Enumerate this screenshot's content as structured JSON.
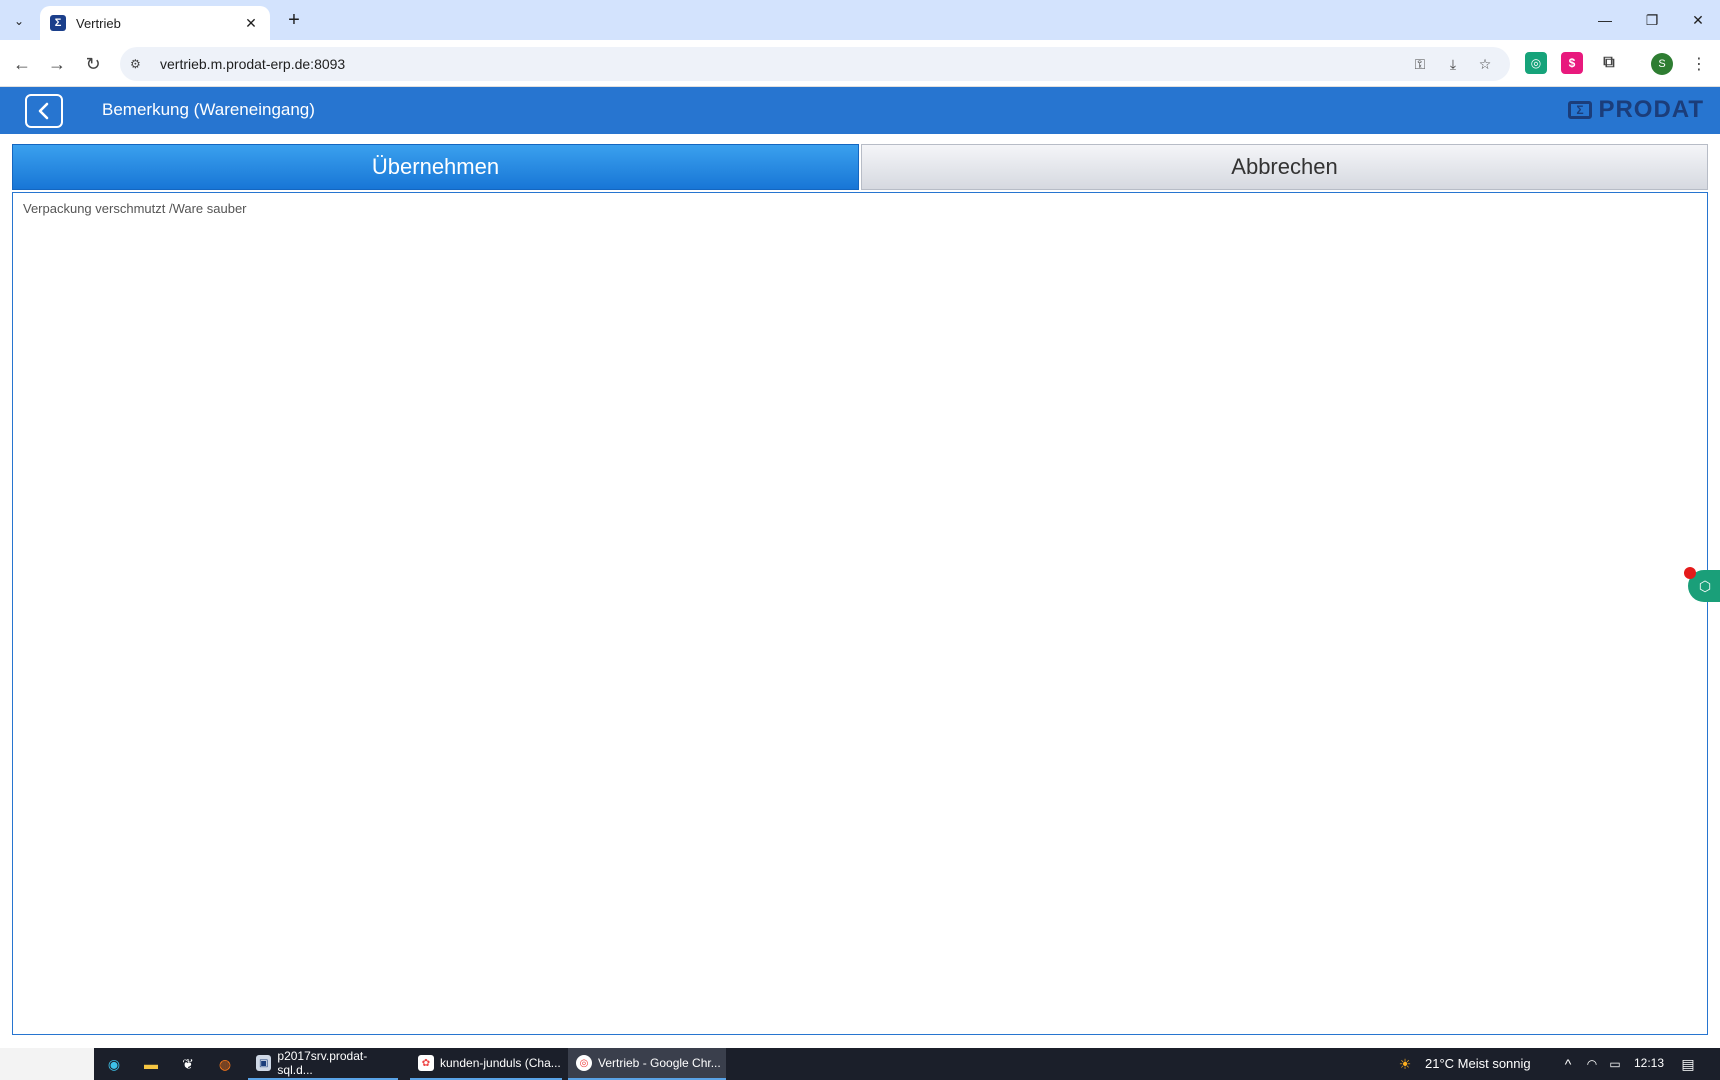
{
  "browser": {
    "tab_title": "Vertrieb",
    "url": "vertrieb.m.prodat-erp.de:8093",
    "new_tab_symbol": "+",
    "close_symbol": "✕",
    "profile_initial": "S"
  },
  "app": {
    "title": "Bemerkung (Wareneingang)",
    "brand": "PRODAT",
    "buttons": {
      "accept": "Übernehmen",
      "cancel": "Abbrechen"
    },
    "remark_text": "Verpackung verschmutzt /Ware sauber"
  },
  "taskbar": {
    "apps": [
      {
        "label": "p2017srv.prodat-sql.d..."
      },
      {
        "label": "kunden-junduls (Cha..."
      },
      {
        "label": "Vertrieb - Google Chr..."
      }
    ],
    "weather": "21°C  Meist sonnig",
    "time": "12:13"
  },
  "colors": {
    "accent": "#2775d0",
    "brand_dark": "#1b3d7a"
  }
}
